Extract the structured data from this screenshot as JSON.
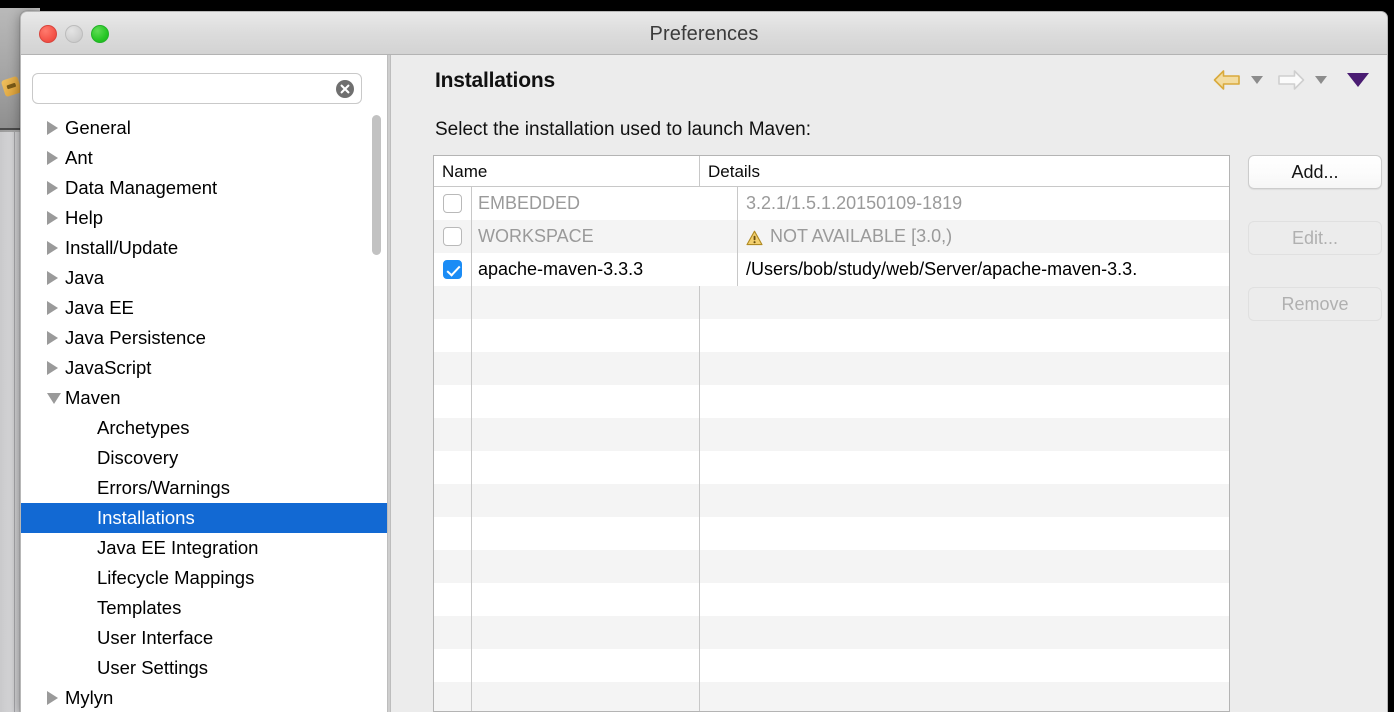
{
  "window": {
    "title": "Preferences",
    "traffic_lights": [
      "close",
      "minimize",
      "zoom"
    ]
  },
  "sidebar": {
    "search": {
      "value": "",
      "placeholder": ""
    },
    "items": [
      {
        "label": "General",
        "level": 0,
        "twisty": "collapsed",
        "selected": false
      },
      {
        "label": "Ant",
        "level": 0,
        "twisty": "collapsed",
        "selected": false
      },
      {
        "label": "Data Management",
        "level": 0,
        "twisty": "collapsed",
        "selected": false
      },
      {
        "label": "Help",
        "level": 0,
        "twisty": "collapsed",
        "selected": false
      },
      {
        "label": "Install/Update",
        "level": 0,
        "twisty": "collapsed",
        "selected": false
      },
      {
        "label": "Java",
        "level": 0,
        "twisty": "collapsed",
        "selected": false
      },
      {
        "label": "Java EE",
        "level": 0,
        "twisty": "collapsed",
        "selected": false
      },
      {
        "label": "Java Persistence",
        "level": 0,
        "twisty": "collapsed",
        "selected": false
      },
      {
        "label": "JavaScript",
        "level": 0,
        "twisty": "collapsed",
        "selected": false
      },
      {
        "label": "Maven",
        "level": 0,
        "twisty": "expanded",
        "selected": false
      },
      {
        "label": "Archetypes",
        "level": 1,
        "twisty": "none",
        "selected": false
      },
      {
        "label": "Discovery",
        "level": 1,
        "twisty": "none",
        "selected": false
      },
      {
        "label": "Errors/Warnings",
        "level": 1,
        "twisty": "none",
        "selected": false
      },
      {
        "label": "Installations",
        "level": 1,
        "twisty": "none",
        "selected": true
      },
      {
        "label": "Java EE Integration",
        "level": 1,
        "twisty": "none",
        "selected": false
      },
      {
        "label": "Lifecycle Mappings",
        "level": 1,
        "twisty": "none",
        "selected": false
      },
      {
        "label": "Templates",
        "level": 1,
        "twisty": "none",
        "selected": false
      },
      {
        "label": "User Interface",
        "level": 1,
        "twisty": "none",
        "selected": false
      },
      {
        "label": "User Settings",
        "level": 1,
        "twisty": "none",
        "selected": false
      },
      {
        "label": "Mylyn",
        "level": 0,
        "twisty": "collapsed",
        "selected": false
      }
    ]
  },
  "page": {
    "title": "Installations",
    "instruction": "Select the installation used to launch Maven:",
    "nav": {
      "back_icon": "back-arrow-icon",
      "back_enabled": true,
      "forward_icon": "forward-arrow-icon",
      "forward_enabled": false,
      "menu_icon": "chevron-down-icon"
    }
  },
  "table": {
    "columns": [
      "Name",
      "Details"
    ],
    "rows": [
      {
        "checked": false,
        "name": "EMBEDDED",
        "details": "3.2.1/1.5.1.20150109-1819",
        "warning": false,
        "dim": true
      },
      {
        "checked": false,
        "name": "WORKSPACE",
        "details": "NOT AVAILABLE [3.0,)",
        "warning": true,
        "warning_icon": "warning-triangle-icon",
        "dim": true
      },
      {
        "checked": true,
        "name": "apache-maven-3.3.3",
        "details": "/Users/bob/study/web/Server/apache-maven-3.3.",
        "warning": false,
        "dim": false
      }
    ],
    "empty_row_count": 13
  },
  "buttons": {
    "add": {
      "label": "Add...",
      "enabled": true
    },
    "edit": {
      "label": "Edit...",
      "enabled": false
    },
    "remove": {
      "label": "Remove",
      "enabled": false
    }
  },
  "colors": {
    "selection_blue": "#1269d3",
    "checkbox_blue": "#1b8cf5",
    "warning_gold": "#e8b63a",
    "back_arrow_gold": "#d9aa3c",
    "menu_purple": "#4a1c72",
    "window_bg": "#ececec"
  }
}
